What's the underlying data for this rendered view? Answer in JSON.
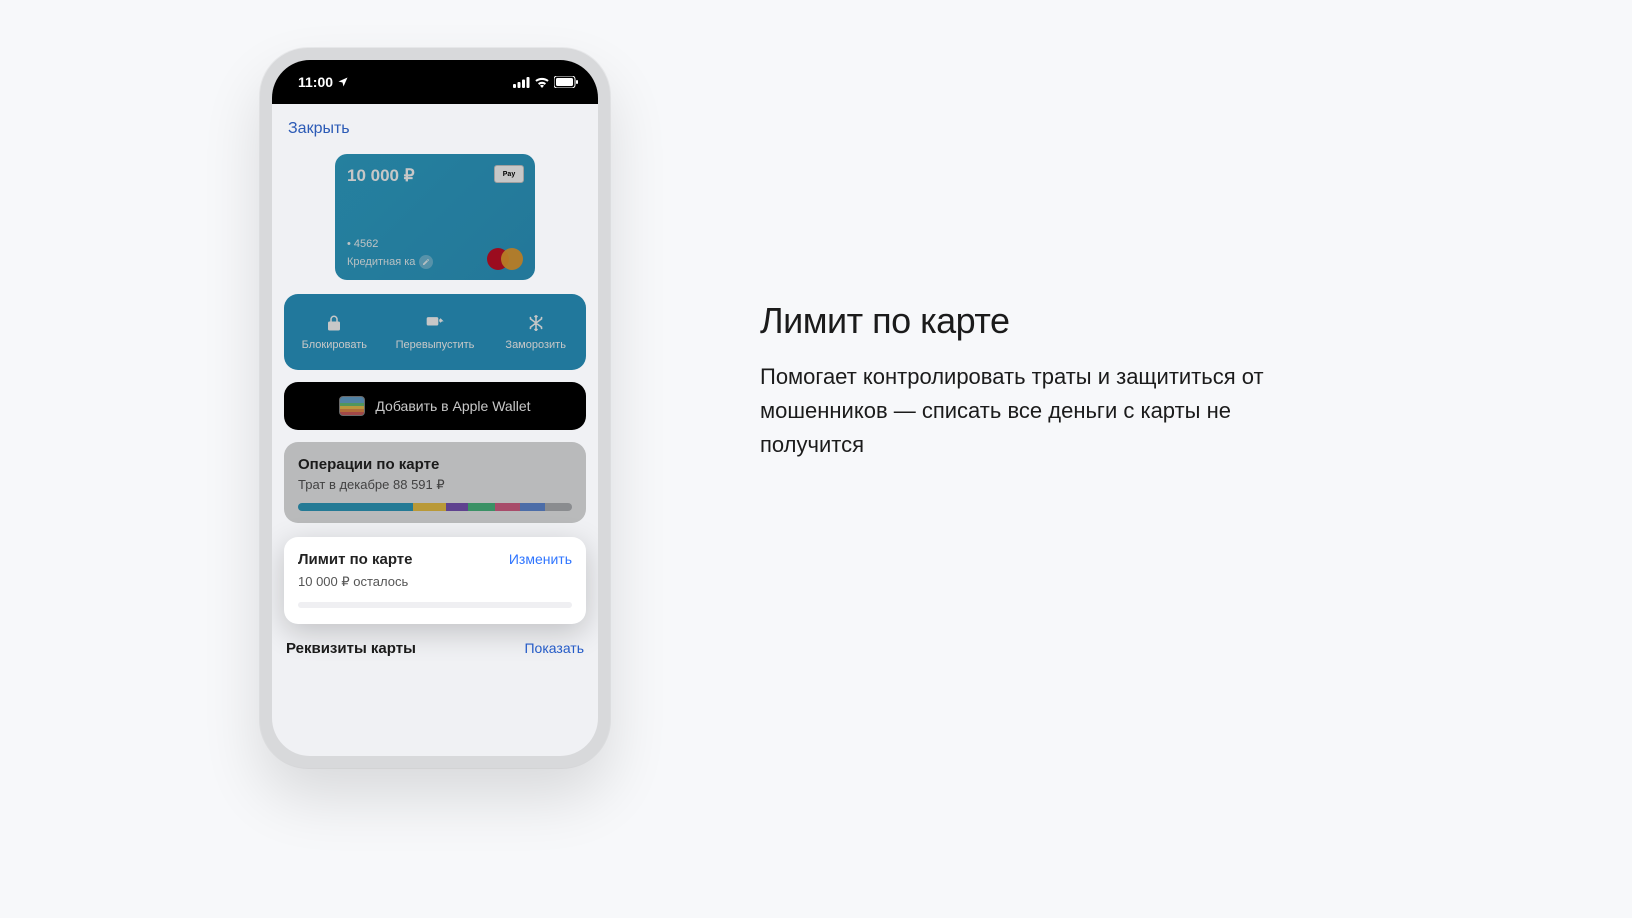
{
  "status": {
    "time": "11:00"
  },
  "nav": {
    "close": "Закрыть"
  },
  "card": {
    "balance": "10 000 ₽",
    "pay_badge": "Pay",
    "last4": "• 4562",
    "type_label": "Кредитная ка"
  },
  "actions": {
    "block": "Блокировать",
    "reissue": "Перевыпустить",
    "freeze": "Заморозить"
  },
  "wallet": {
    "label": "Добавить в Apple Wallet"
  },
  "ops": {
    "title": "Операции по карте",
    "subtitle": "Трат в декабре 88 591 ₽",
    "segments": [
      {
        "color": "#1fa0c9",
        "width": 42
      },
      {
        "color": "#f4c430",
        "width": 12
      },
      {
        "color": "#7d52c6",
        "width": 8
      },
      {
        "color": "#3cbf7c",
        "width": 10
      },
      {
        "color": "#e85c8a",
        "width": 9
      },
      {
        "color": "#5b8de6",
        "width": 9
      },
      {
        "color": "#b0b3b8",
        "width": 10
      }
    ]
  },
  "limit": {
    "title": "Лимит по карте",
    "action": "Изменить",
    "subtitle": "10 000 ₽ осталось"
  },
  "requisites": {
    "title": "Реквизиты карты",
    "action": "Показать"
  },
  "marketing": {
    "heading": "Лимит по карте",
    "body": "Помогает контролировать траты и защититься от мошенников — списать все деньги с карты не получится"
  }
}
